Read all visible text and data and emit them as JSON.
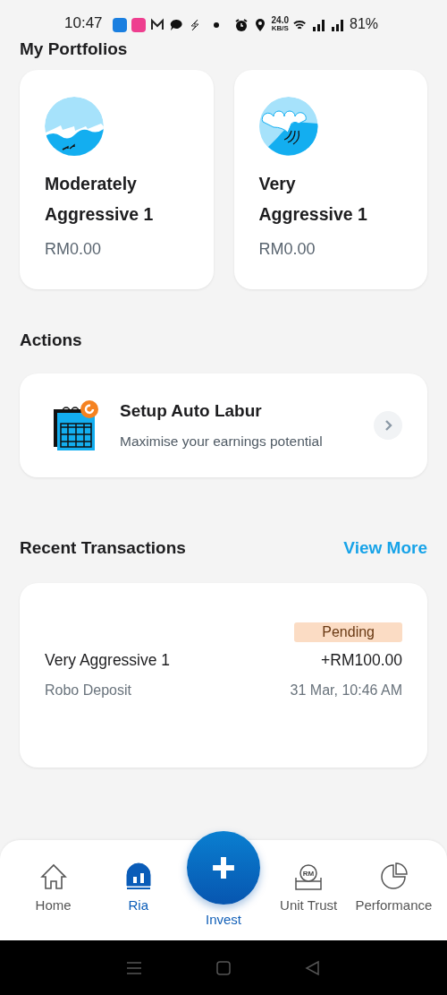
{
  "status_bar": {
    "time": "10:47",
    "speed": "24.0",
    "speed_unit": "KB/S",
    "battery": "81%"
  },
  "portfolios": {
    "title": "My Portfolios",
    "items": [
      {
        "name": "Moderately Aggressive 1",
        "value": "RM0.00"
      },
      {
        "name": "Very Aggressive 1",
        "value": "RM0.00"
      }
    ]
  },
  "actions": {
    "title": "Actions",
    "items": [
      {
        "title": "Setup Auto Labur",
        "subtitle": "Maximise your earnings potential"
      }
    ]
  },
  "recent_transactions": {
    "title": "Recent Transactions",
    "link": "View More",
    "items": [
      {
        "status": "Pending",
        "name": "Very Aggressive 1",
        "amount": "+RM100.00",
        "type": "Robo Deposit",
        "date": "31 Mar, 10:46 AM"
      }
    ]
  },
  "bottom_nav": [
    {
      "label": "Home",
      "kind": "tab",
      "selected": false
    },
    {
      "label": "Ria",
      "kind": "tab",
      "selected": true
    },
    {
      "label": "Invest",
      "kind": "fab",
      "selected": false
    },
    {
      "label": "Unit Trust",
      "kind": "tab",
      "selected": false,
      "icon_text": "RM"
    },
    {
      "label": "Performance",
      "kind": "tab",
      "selected": false
    }
  ]
}
